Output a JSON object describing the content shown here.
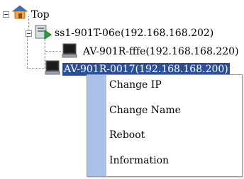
{
  "tree": {
    "root": {
      "label": "Top",
      "icon": "home-icon"
    },
    "switch": {
      "label": "ss1-901T-06e(192.168.168.202)",
      "icon": "switch-device-icon"
    },
    "children": [
      {
        "label": "AV-901R-fffe(192.168.168.220)",
        "icon": "monitor-device-icon"
      },
      {
        "label": "AV-901R-0017(192.168.168.200)",
        "icon": "monitor-device-icon",
        "selected": true
      }
    ]
  },
  "context_menu": {
    "items": [
      {
        "label": "Change IP"
      },
      {
        "label": "Change Name"
      },
      {
        "label": "Reboot"
      },
      {
        "label": "Information"
      }
    ]
  }
}
